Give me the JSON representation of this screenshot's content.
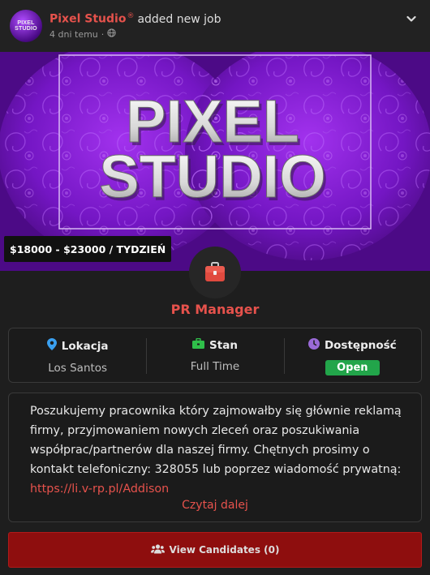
{
  "header": {
    "author": "Pixel Studio",
    "registered_mark": "®",
    "action": "added new job",
    "time": "4 dni temu",
    "separator": "·",
    "avatar_text_line1": "PIXEL",
    "avatar_text_line2": "STUDIO"
  },
  "banner": {
    "logo_line1": "PIXEL",
    "logo_line2": "STUDIO",
    "salary": "$18000 - $23000 / TYDZIEŃ"
  },
  "job": {
    "title": "PR Manager"
  },
  "info": {
    "location_label": "Lokacja",
    "location_value": "Los Santos",
    "status_label": "Stan",
    "status_value": "Full Time",
    "availability_label": "Dostępność",
    "availability_value": "Open"
  },
  "description": {
    "text": "Poszukujemy pracownika który zajmowałby się głównie reklamą firmy, przyjmowaniem nowych zleceń oraz poszukiwania współprac/partnerów dla naszej firmy. Chętnych prosimy o kontakt telefoniczny: 328055 lub poprzez wiadomość prywatną: ",
    "link": "https://li.v-rp.pl/Addison",
    "read_more": "Czytaj dalej"
  },
  "actions": {
    "view_candidates": "View Candidates (0)"
  },
  "colors": {
    "accent": "#e6524c",
    "open_badge": "#22a54a",
    "button_bg": "#8e0e0e",
    "location_icon": "#3aa0f0",
    "status_icon": "#2fbf4a",
    "availability_icon": "#9a6ad8"
  },
  "icons": {
    "globe": "globe-icon",
    "chevron": "chevron-down-icon",
    "briefcase": "briefcase-icon",
    "location": "map-marker-icon",
    "status": "briefcase-icon",
    "availability": "clock-icon",
    "candidates": "users-icon"
  }
}
